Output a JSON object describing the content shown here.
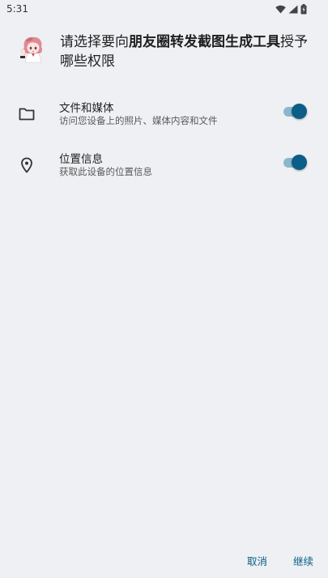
{
  "status_bar": {
    "time": "5:31",
    "icons": [
      "wifi-icon",
      "signal-icon",
      "battery-icon"
    ]
  },
  "header": {
    "title_prefix": "请选择要向",
    "app_name": "朋友圈转发截图生成工具",
    "title_suffix": "授予哪些权限"
  },
  "permissions": [
    {
      "label": "文件和媒体",
      "description": "访问您设备上的照片、媒体内容和文件",
      "icon": "folder-icon",
      "enabled": true
    },
    {
      "label": "位置信息",
      "description": "获取此设备的位置信息",
      "icon": "location-pin-icon",
      "enabled": true
    }
  ],
  "footer": {
    "cancel_label": "取消",
    "continue_label": "继续"
  },
  "colors": {
    "background": "#eef0f3",
    "accent": "#0a5e87",
    "toggle_track": "#8ab7cd"
  }
}
